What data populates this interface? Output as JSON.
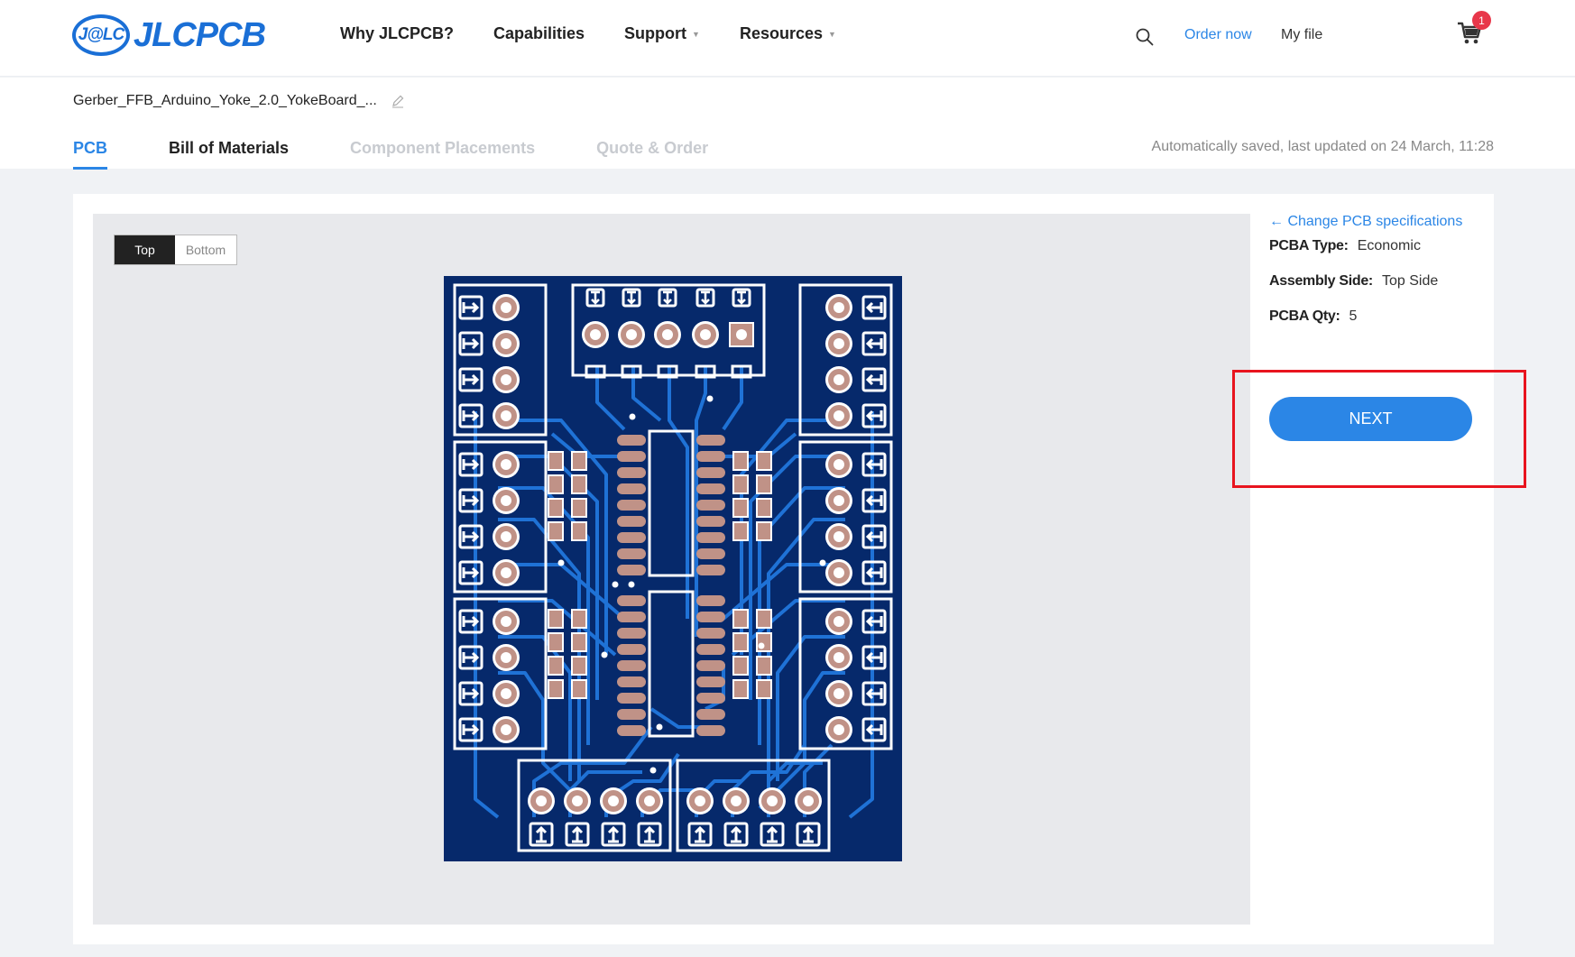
{
  "header": {
    "logo_badge": "J@LC",
    "logo_text": "JLCPCB",
    "nav": [
      "Why JLCPCB?",
      "Capabilities",
      "Support",
      "Resources"
    ],
    "order_now": "Order now",
    "my_file": "My file",
    "cart_count": "1",
    "icons": {
      "search": "search-icon",
      "cart": "cart-icon",
      "edit": "pencil-icon"
    }
  },
  "file": {
    "name": "Gerber_FFB_Arduino_Yoke_2.0_YokeBoard_..."
  },
  "tabs": [
    {
      "label": "PCB",
      "state": "active"
    },
    {
      "label": "Bill of Materials",
      "state": "enabled"
    },
    {
      "label": "Component Placements",
      "state": "disabled"
    },
    {
      "label": "Quote & Order",
      "state": "disabled"
    }
  ],
  "saved_status": "Automatically saved, last updated on 24 March, 11:28",
  "viewer": {
    "side_toggle": [
      "Top",
      "Bottom"
    ],
    "selected_side": "Top"
  },
  "specs": {
    "change_link": "← Change PCB specifications",
    "pcba_type_label": "PCBA Type:",
    "pcba_type_value": "Economic",
    "assembly_side_label": "Assembly Side:",
    "assembly_side_value": "Top Side",
    "pcba_qty_label": "PCBA Qty:",
    "pcba_qty_value": "5",
    "next_label": "NEXT"
  },
  "colors": {
    "accent": "#2b86e6",
    "pcb_board": "#06296b",
    "pcb_trace": "#1f72d6",
    "pad": "#c09287",
    "highlight": "#e8141e"
  }
}
